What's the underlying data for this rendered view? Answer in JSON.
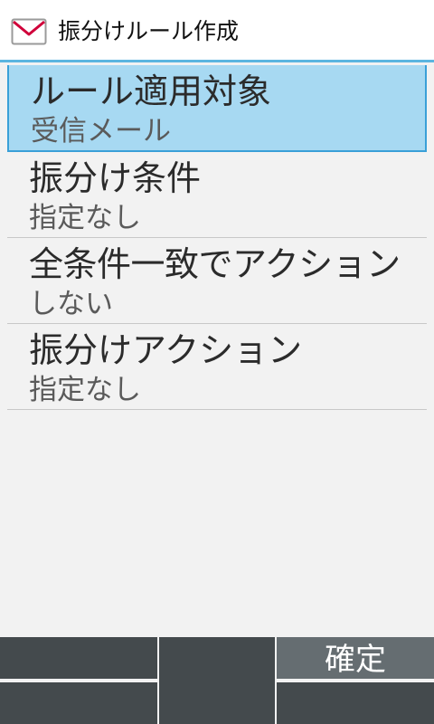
{
  "header": {
    "title": "振分けルール作成",
    "icon": "mail-icon"
  },
  "items": [
    {
      "title": "ルール適用対象",
      "value": "受信メール",
      "selected": true
    },
    {
      "title": "振分け条件",
      "value": "指定なし",
      "selected": false
    },
    {
      "title": "全条件一致でアクション",
      "value": "しない",
      "selected": false
    },
    {
      "title": "振分けアクション",
      "value": "指定なし",
      "selected": false
    }
  ],
  "softkeys": {
    "right_label": "確定"
  },
  "colors": {
    "selected_bg": "#a7d9f2",
    "accent": "#5bb5e0",
    "softkey_bg": "#444a4d",
    "softkey_active": "#656d71"
  }
}
